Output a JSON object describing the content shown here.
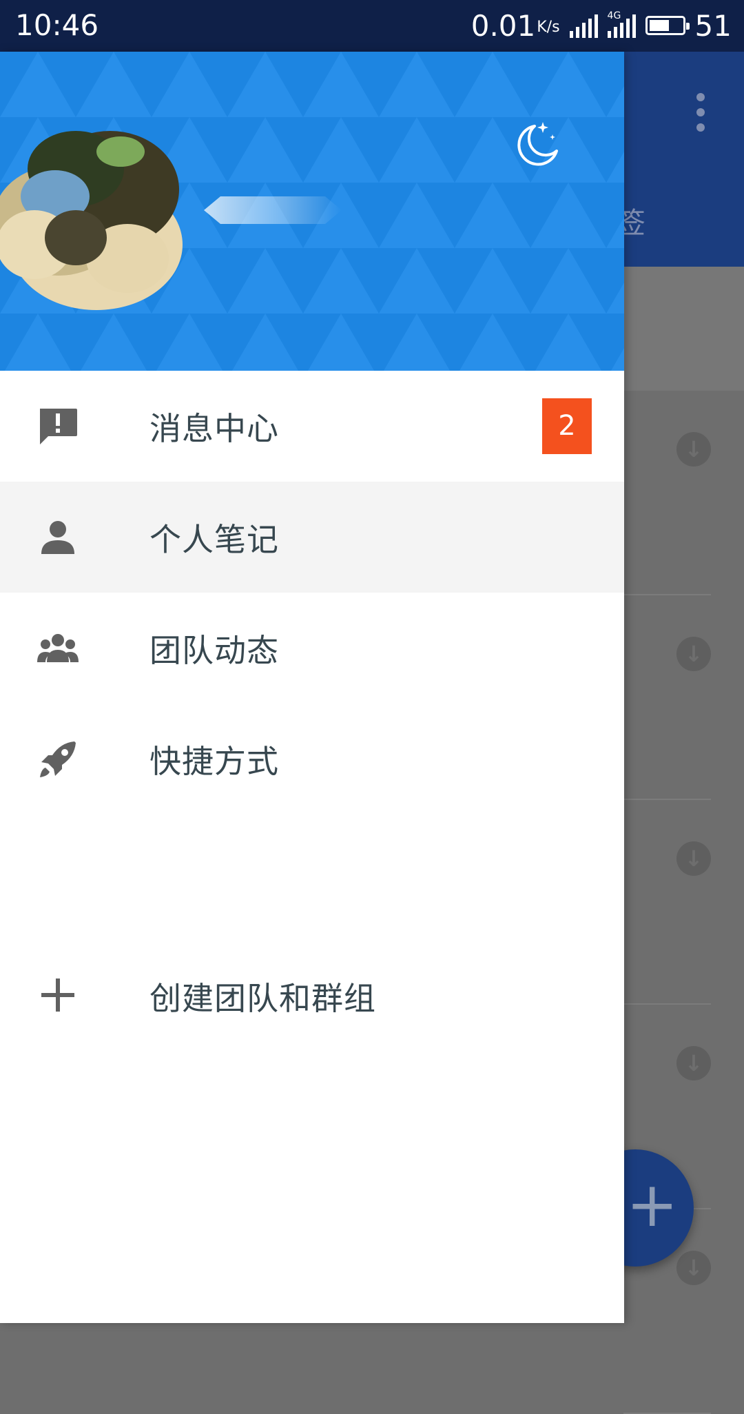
{
  "status_bar": {
    "time": "10:46",
    "net_speed": "0.01",
    "net_speed_unit": "K/s",
    "network_type": "4G",
    "battery_level": "51"
  },
  "drawer": {
    "header": {
      "avatar": "user-avatar",
      "username_redacted": true,
      "night_mode_icon": "moon-icon"
    },
    "menu": [
      {
        "icon": "message-alert-icon",
        "label": "消息中心",
        "badge": "2"
      },
      {
        "icon": "person-icon",
        "label": "个人笔记",
        "active": true
      },
      {
        "icon": "group-icon",
        "label": "团队动态"
      },
      {
        "icon": "rocket-icon",
        "label": "快捷方式"
      }
    ],
    "create": {
      "icon": "plus-icon",
      "label": "创建团队和群组"
    }
  },
  "background_app": {
    "tab_partial": "签",
    "more_icon": "more-vert-icon",
    "row_icon": "download-icon",
    "fab_icon": "plus-icon"
  },
  "colors": {
    "status_bar": "#0f2048",
    "drawer_header": "#1e88e5",
    "badge": "#f4511e",
    "menu_text": "#37474f",
    "icon": "#616161"
  }
}
